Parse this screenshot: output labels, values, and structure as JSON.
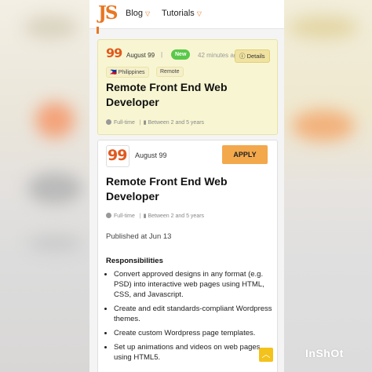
{
  "nav": {
    "logo": "JS",
    "items": [
      {
        "label": "Blog"
      },
      {
        "label": "Tutorials"
      }
    ]
  },
  "jobs": [
    {
      "company_logo": "99",
      "company": "August 99",
      "badge": "New",
      "posted": "42 minutes ago",
      "details_label": "Details",
      "tags": [
        "Philippines",
        "Remote"
      ],
      "title": "Remote Front End Web Developer",
      "type": "Full-time",
      "experience": "Between 2 and 5 years"
    },
    {
      "company_logo": "99",
      "company": "August 99",
      "apply_label": "APPLY",
      "title": "Remote Front End Web Developer",
      "type": "Full-time",
      "experience": "Between 2 and 5 years",
      "published": "Published at Jun 13",
      "responsibilities_heading": "Responsibilities",
      "responsibilities": [
        "Convert approved designs in any format (e.g. PSD) into interactive web pages using HTML, CSS, and Javascript.",
        "Create and edit standards-compliant Wordpress themes.",
        "Create custom Wordpress page templates.",
        "Set up animations and videos on web pages using HTML5."
      ]
    }
  ],
  "watermark": "InShOt",
  "colors": {
    "accent": "#e87722",
    "new_badge": "#5ac84a",
    "apply": "#f3a84c",
    "highlight_card": "#f8f6d2"
  }
}
